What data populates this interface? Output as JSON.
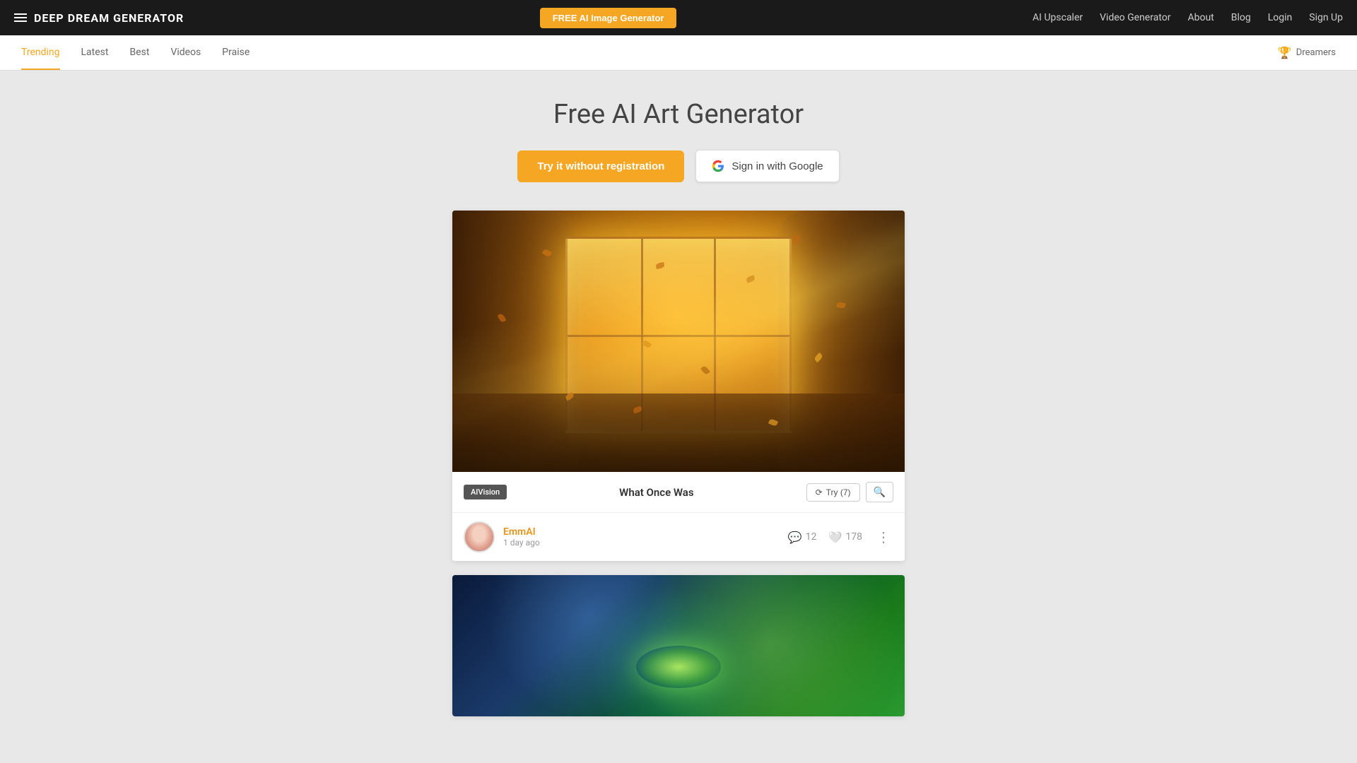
{
  "navbar": {
    "brand": "DEEP DREAM GENERATOR",
    "free_ai_btn": "FREE AI Image Generator",
    "links": [
      {
        "id": "ai-upscaler",
        "label": "AI Upscaler"
      },
      {
        "id": "video-generator",
        "label": "Video Generator"
      },
      {
        "id": "about",
        "label": "About"
      },
      {
        "id": "blog",
        "label": "Blog"
      },
      {
        "id": "login",
        "label": "Login"
      },
      {
        "id": "signup",
        "label": "Sign Up"
      }
    ]
  },
  "subnav": {
    "tabs": [
      {
        "id": "trending",
        "label": "Trending",
        "active": true
      },
      {
        "id": "latest",
        "label": "Latest",
        "active": false
      },
      {
        "id": "best",
        "label": "Best",
        "active": false
      },
      {
        "id": "videos",
        "label": "Videos",
        "active": false
      },
      {
        "id": "praise",
        "label": "Praise",
        "active": false
      }
    ],
    "dreamers": "Dreamers"
  },
  "hero": {
    "title": "Free AI Art Generator",
    "try_btn": "Try it without registration",
    "google_btn": "Sign in with Google"
  },
  "featured_image": {
    "style_badge": "AIVision",
    "title": "What Once Was",
    "try_label": "Try (7)",
    "user": {
      "name": "EmmAI",
      "time": "1 day ago"
    },
    "comments": "12",
    "likes": "178"
  }
}
